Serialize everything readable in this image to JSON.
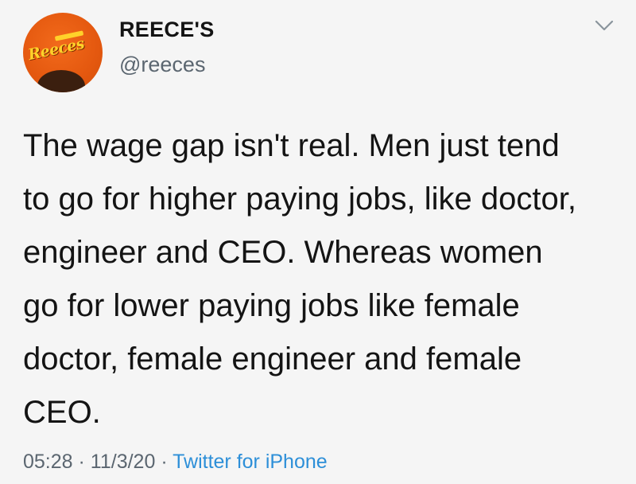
{
  "author": {
    "display_name": "REECE'S",
    "handle": "@reeces",
    "avatar_logo_text": "Reeces"
  },
  "tweet": {
    "text": "The wage gap isn't real. Men just tend\nto go for higher paying jobs, like doctor,\nengineer and CEO. Whereas women\ngo for lower paying jobs like female\ndoctor, female engineer and female\nCEO.",
    "time": "05:28",
    "date": "11/3/20",
    "separator": "·",
    "source": "Twitter for iPhone"
  },
  "icons": {
    "menu": "chevron-down-icon"
  },
  "colors": {
    "background": "#f5f5f5",
    "text": "#141414",
    "muted": "#5b6670",
    "link": "#2d8fd8",
    "brand_orange": "#e4580f",
    "brand_yellow": "#ffd22a"
  }
}
